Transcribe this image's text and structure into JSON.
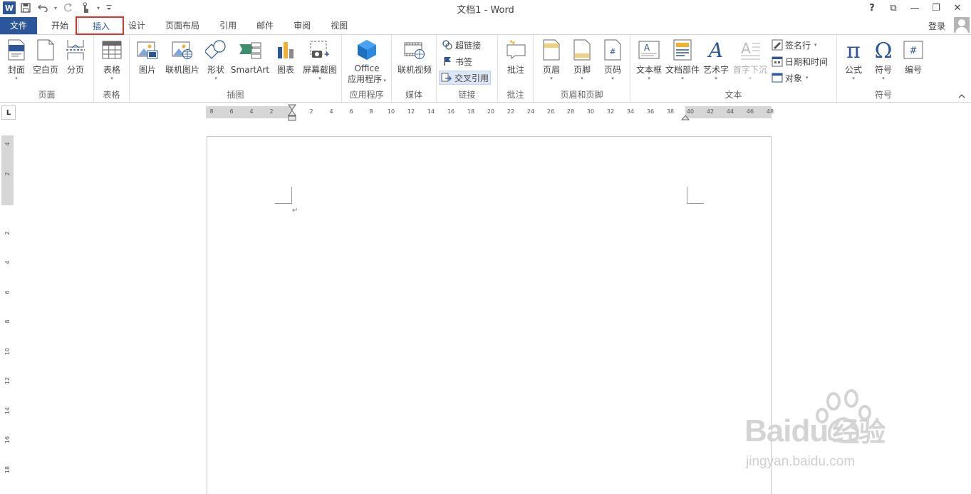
{
  "window": {
    "title": "文档1 - Word",
    "controls": {
      "help": "?",
      "ribbon_options": "⧉",
      "minimize": "—",
      "restore": "❐",
      "close": "✕"
    }
  },
  "quick_access": {
    "app_icon_letter": "W"
  },
  "tabs": [
    {
      "label": "文件"
    },
    {
      "label": "开始"
    },
    {
      "label": "插入"
    },
    {
      "label": "设计"
    },
    {
      "label": "页面布局"
    },
    {
      "label": "引用"
    },
    {
      "label": "邮件"
    },
    {
      "label": "审阅"
    },
    {
      "label": "视图"
    }
  ],
  "active_tab": "插入",
  "account": {
    "signin_label": "登录"
  },
  "ribbon": {
    "pages": {
      "label": "页面",
      "cover": "封面",
      "blank": "空白页",
      "break": "分页"
    },
    "tables": {
      "label": "表格",
      "table": "表格"
    },
    "illustrations": {
      "label": "插图",
      "picture": "图片",
      "online_picture": "联机图片",
      "shapes": "形状",
      "smartart": "SmartArt",
      "chart": "图表",
      "screenshot": "屏幕截图"
    },
    "apps": {
      "label": "应用程序",
      "office_line1": "Office",
      "office_line2": "应用程序"
    },
    "media": {
      "label": "媒体",
      "online_video": "联机视频"
    },
    "links": {
      "label": "链接",
      "hyperlink": "超链接",
      "bookmark": "书签",
      "crossref": "交叉引用"
    },
    "comments": {
      "label": "批注",
      "comment": "批注"
    },
    "header_footer": {
      "label": "页眉和页脚",
      "header": "页眉",
      "footer": "页脚",
      "page_number": "页码"
    },
    "text": {
      "label": "文本",
      "textbox": "文本框",
      "quickparts": "文档部件",
      "wordart": "艺术字",
      "dropcap": "首字下沉",
      "signature": "签名行",
      "datetime": "日期和时间",
      "object": "对象"
    },
    "symbols": {
      "label": "符号",
      "equation": "公式",
      "symbol": "符号",
      "numbering": "编号"
    }
  },
  "ruler": {
    "tab_selector": "L",
    "h_ticks": [
      "8",
      "6",
      "4",
      "2",
      "",
      "2",
      "4",
      "6",
      "8",
      "10",
      "12",
      "14",
      "16",
      "18",
      "20",
      "22",
      "24",
      "26",
      "28",
      "30",
      "32",
      "34",
      "36",
      "38",
      "40",
      "42",
      "44",
      "46",
      "48"
    ],
    "v_ticks": [
      "4",
      "2",
      "",
      "2",
      "4",
      "6",
      "8",
      "10",
      "12",
      "14",
      "16",
      "18"
    ]
  },
  "document": {
    "pilcrow": "↵"
  },
  "watermark": {
    "brand": "Baidu",
    "brand_cn": "经验",
    "url": "jingyan.baidu.com"
  },
  "colors": {
    "accent": "#2b579a",
    "highlight": "#e03030"
  }
}
